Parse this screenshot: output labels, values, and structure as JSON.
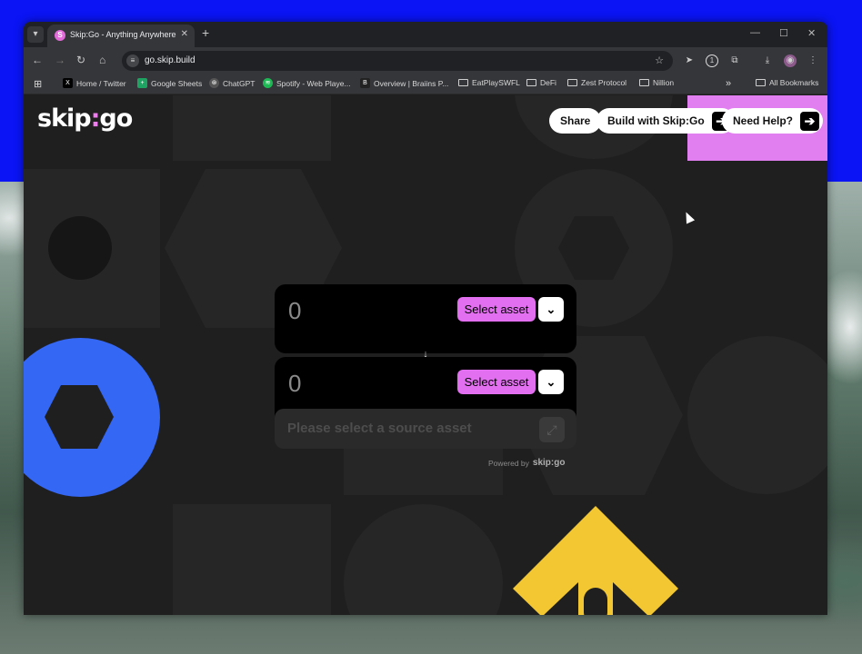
{
  "browser": {
    "tab_title": "Skip:Go - Anything Anywhere",
    "tab_favicon": "S",
    "url": "go.skip.build",
    "bookmarks": [
      {
        "label": "Home / Twitter",
        "icon": "x-icon"
      },
      {
        "label": "Google Sheets",
        "icon": "sheets-icon"
      },
      {
        "label": "ChatGPT",
        "icon": "chatgpt-icon"
      },
      {
        "label": "Spotify - Web Playe...",
        "icon": "spotify-icon"
      },
      {
        "label": "Overview | Braiins P...",
        "icon": "braiins-icon"
      },
      {
        "label": "EatPlaySWFL",
        "icon": "folder-icon"
      },
      {
        "label": "DeFi",
        "icon": "folder-icon"
      },
      {
        "label": "Zest Protocol",
        "icon": "folder-icon"
      },
      {
        "label": "Nillion",
        "icon": "folder-icon"
      }
    ],
    "more_bookmarks": "»",
    "all_bookmarks": "All Bookmarks"
  },
  "header": {
    "logo_left": "skip",
    "logo_sep": ":",
    "logo_right": "go",
    "share_label": "Share",
    "build_label": "Build with Skip:Go",
    "help_label": "Need Help?"
  },
  "swap": {
    "source_amount": "0",
    "dest_amount": "0",
    "select_asset_label": "Select asset",
    "cta_label": "Please select a source asset",
    "powered_by": "Powered by",
    "powered_logo": "skip:go"
  },
  "colors": {
    "accent_pink": "#e26ef0",
    "shape_blue": "#3567f5",
    "shape_yellow": "#f2c731"
  }
}
